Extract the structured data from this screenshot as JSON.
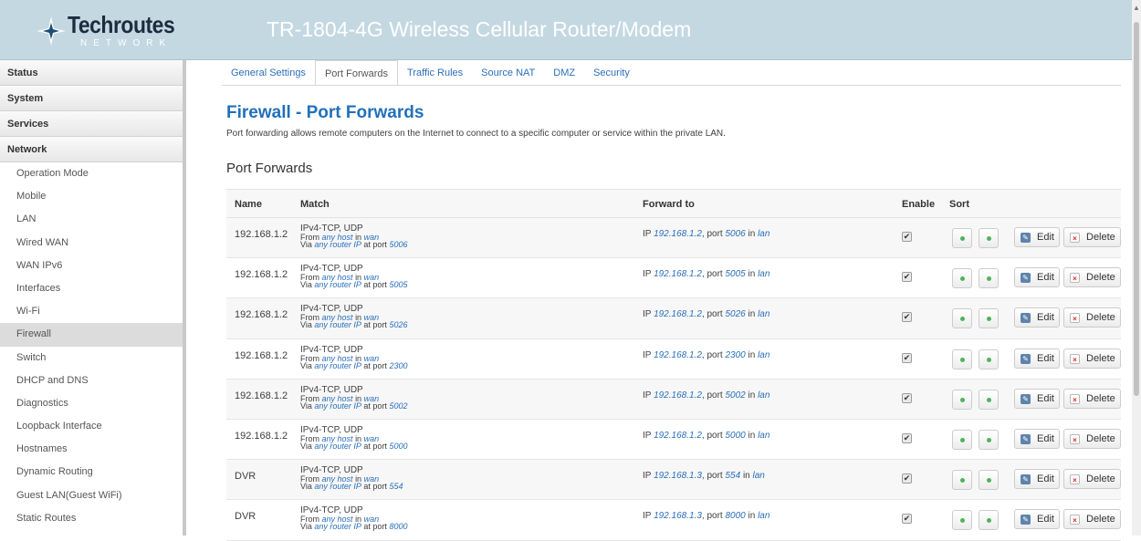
{
  "header": {
    "logo_text": "Techroutes",
    "logo_sub": "NETWORK",
    "title": "TR-1804-4G Wireless Cellular Router/Modem"
  },
  "sidebar": {
    "categories": [
      "Status",
      "System",
      "Services",
      "Network"
    ],
    "items": [
      "Operation Mode",
      "Mobile",
      "LAN",
      "Wired WAN",
      "WAN IPv6",
      "Interfaces",
      "Wi-Fi",
      "Firewall",
      "Switch",
      "DHCP and DNS",
      "Diagnostics",
      "Loopback Interface",
      "Hostnames",
      "Dynamic Routing",
      "Guest LAN(Guest WiFi)",
      "Static Routes"
    ],
    "active_item": "Firewall"
  },
  "tabs": [
    "General Settings",
    "Port Forwards",
    "Traffic Rules",
    "Source NAT",
    "DMZ",
    "Security"
  ],
  "active_tab": "Port Forwards",
  "page": {
    "title": "Firewall - Port Forwards",
    "description": "Port forwarding allows remote computers on the Internet to connect to a specific computer or service within the private LAN.",
    "section_title": "Port Forwards"
  },
  "table": {
    "headers": {
      "name": "Name",
      "match": "Match",
      "forward": "Forward to",
      "enable": "Enable",
      "sort": "Sort"
    },
    "rows": [
      {
        "name": "192.168.1.2",
        "proto": "IPv4-TCP, UDP",
        "from_host": "any host",
        "from_zone": "wan",
        "via_ip": "any router IP",
        "via_port": "5006",
        "fwd_ip": "192.168.1.2",
        "fwd_port": "5006",
        "fwd_zone": "lan",
        "enabled": true
      },
      {
        "name": "192.168.1.2",
        "proto": "IPv4-TCP, UDP",
        "from_host": "any host",
        "from_zone": "wan",
        "via_ip": "any router IP",
        "via_port": "5005",
        "fwd_ip": "192.168.1.2",
        "fwd_port": "5005",
        "fwd_zone": "lan",
        "enabled": true
      },
      {
        "name": "192.168.1.2",
        "proto": "IPv4-TCP, UDP",
        "from_host": "any host",
        "from_zone": "wan",
        "via_ip": "any router IP",
        "via_port": "5026",
        "fwd_ip": "192.168.1.2",
        "fwd_port": "5026",
        "fwd_zone": "lan",
        "enabled": true
      },
      {
        "name": "192.168.1.2",
        "proto": "IPv4-TCP, UDP",
        "from_host": "any host",
        "from_zone": "wan",
        "via_ip": "any router IP",
        "via_port": "2300",
        "fwd_ip": "192.168.1.2",
        "fwd_port": "2300",
        "fwd_zone": "lan",
        "enabled": true
      },
      {
        "name": "192.168.1.2",
        "proto": "IPv4-TCP, UDP",
        "from_host": "any host",
        "from_zone": "wan",
        "via_ip": "any router IP",
        "via_port": "5002",
        "fwd_ip": "192.168.1.2",
        "fwd_port": "5002",
        "fwd_zone": "lan",
        "enabled": true
      },
      {
        "name": "192.168.1.2",
        "proto": "IPv4-TCP, UDP",
        "from_host": "any host",
        "from_zone": "wan",
        "via_ip": "any router IP",
        "via_port": "5000",
        "fwd_ip": "192.168.1.2",
        "fwd_port": "5000",
        "fwd_zone": "lan",
        "enabled": true
      },
      {
        "name": "DVR",
        "proto": "IPv4-TCP, UDP",
        "from_host": "any host",
        "from_zone": "wan",
        "via_ip": "any router IP",
        "via_port": "554",
        "fwd_ip": "192.168.1.3",
        "fwd_port": "554",
        "fwd_zone": "lan",
        "enabled": true
      },
      {
        "name": "DVR",
        "proto": "IPv4-TCP, UDP",
        "from_host": "any host",
        "from_zone": "wan",
        "via_ip": "any router IP",
        "via_port": "8000",
        "fwd_ip": "192.168.1.3",
        "fwd_port": "8000",
        "fwd_zone": "lan",
        "enabled": true
      }
    ],
    "labels": {
      "from": "From",
      "in": "in",
      "via": "Via",
      "at_port": "at port",
      "ip": "IP",
      "port": "port",
      "edit": "Edit",
      "delete": "Delete"
    }
  },
  "icons": [
    "logo-star-icon",
    "move-up-icon",
    "move-down-icon",
    "edit-icon",
    "delete-icon",
    "checkbox-check-icon",
    "scroll-up-icon"
  ],
  "colors": {
    "header_bg": "#c4d8e2",
    "title_blue": "#2270bb",
    "link_blue": "#2a6fba",
    "sort_green": "#52b25b"
  }
}
